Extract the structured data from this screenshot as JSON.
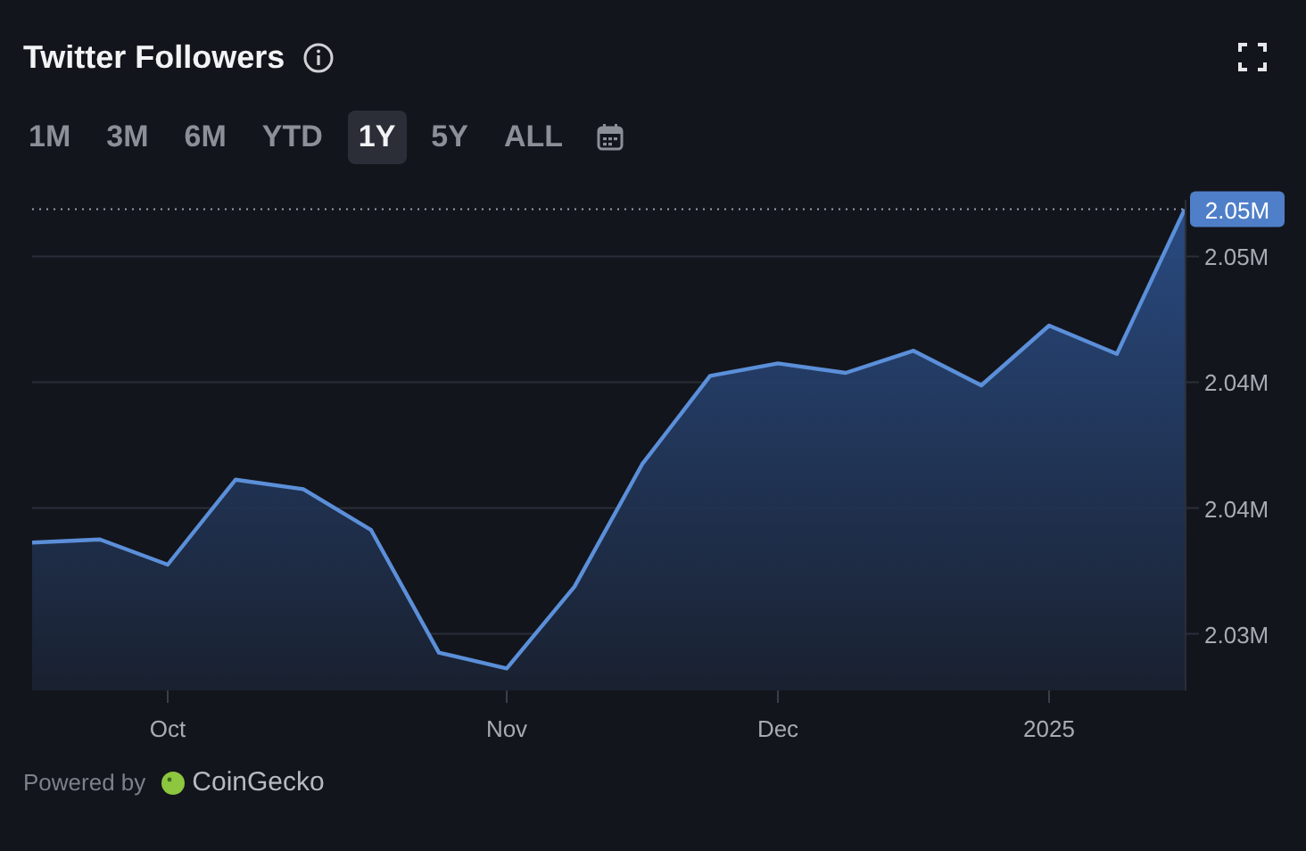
{
  "header": {
    "title": "Twitter Followers"
  },
  "ranges": [
    {
      "label": "1M",
      "selected": false
    },
    {
      "label": "3M",
      "selected": false
    },
    {
      "label": "6M",
      "selected": false
    },
    {
      "label": "YTD",
      "selected": false
    },
    {
      "label": "1Y",
      "selected": true
    },
    {
      "label": "5Y",
      "selected": false
    },
    {
      "label": "ALL",
      "selected": false
    }
  ],
  "chart": {
    "chart_data": {
      "type": "area",
      "grid": true,
      "ref_lines": [
        {
          "value": 2.0475,
          "label": "2.05M",
          "axis": "y"
        }
      ],
      "ylim": [
        2.0322,
        2.0478
      ],
      "categories": [
        null,
        null,
        "Oct",
        null,
        null,
        null,
        null,
        "Nov",
        null,
        null,
        null,
        "Dec",
        null,
        null,
        null,
        "2025",
        null,
        null
      ],
      "series": [
        {
          "color": "#5b8fd9",
          "values": [
            2.0369,
            2.037,
            2.0362,
            2.0389,
            2.0386,
            2.0373,
            2.0334,
            2.0329,
            2.0355,
            2.0394,
            2.0422,
            2.0426,
            2.0423,
            2.043,
            2.0419,
            2.0438,
            2.0429,
            2.0475
          ]
        }
      ],
      "yticks": [
        {
          "value": 2.034,
          "label": "2.03M"
        },
        {
          "value": 2.038,
          "label": "2.04M"
        },
        {
          "value": 2.042,
          "label": "2.04M"
        },
        {
          "value": 2.046,
          "label": "2.05M"
        }
      ]
    }
  },
  "footer": {
    "prefix": "Powered by",
    "brand": "CoinGecko"
  }
}
